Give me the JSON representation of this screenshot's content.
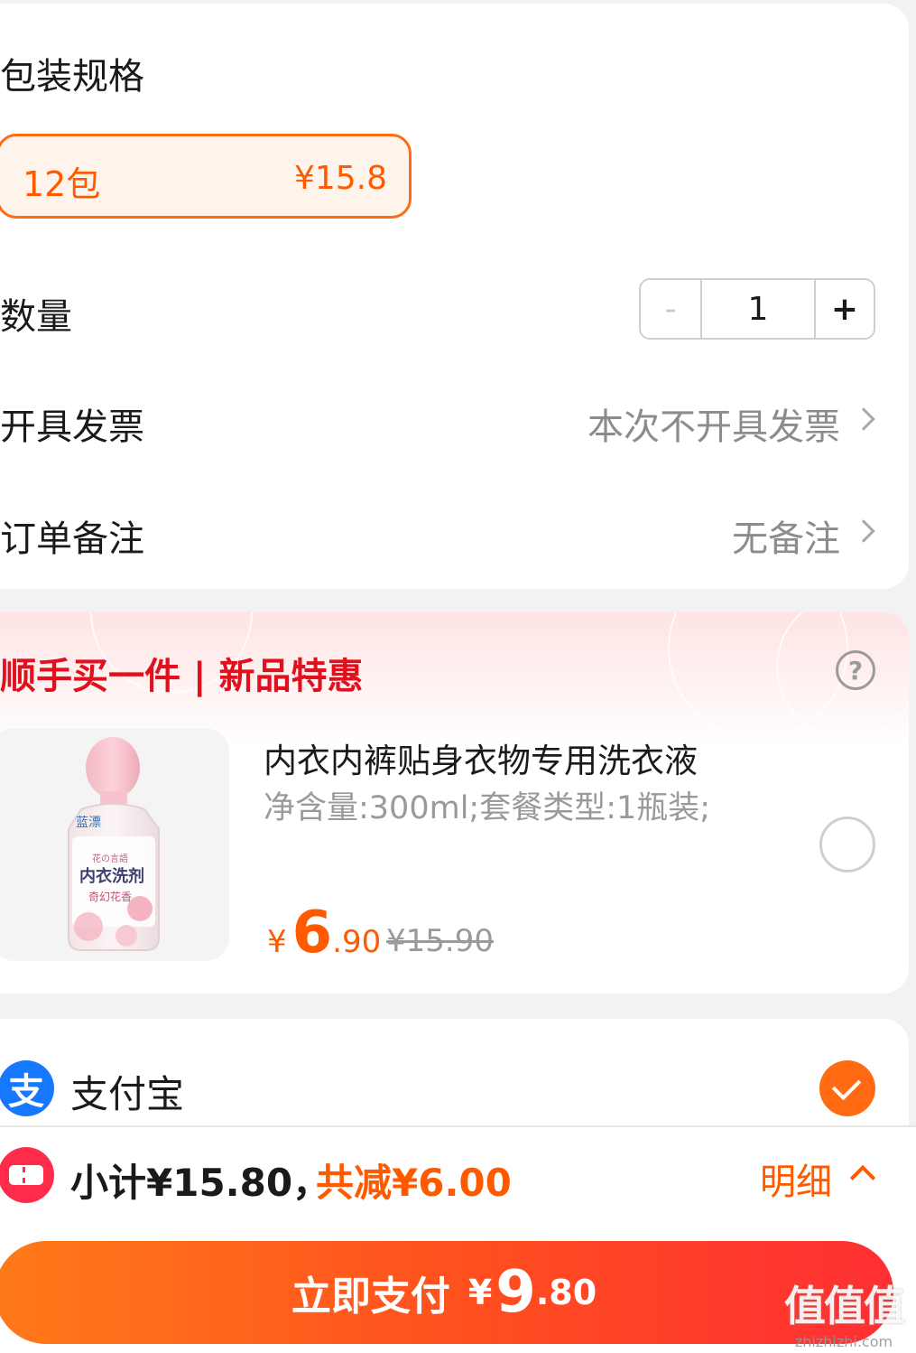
{
  "options": {
    "spec_label": "包装规格",
    "spec_chip": {
      "name": "12包",
      "price": "¥15.8"
    },
    "quantity_label": "数量",
    "quantity": {
      "minus": "-",
      "value": "1",
      "plus": "+"
    },
    "invoice_label": "开具发票",
    "invoice_value": "本次不开具发票",
    "remark_label": "订单备注",
    "remark_value": "无备注"
  },
  "upsell": {
    "title": "顺手买一件 | 新品特惠",
    "help_icon": "?",
    "product": {
      "name": "内衣内裤贴身衣物专用洗衣液",
      "spec": "净含量:300ml;套餐类型:1瓶装;",
      "price_symbol": "¥",
      "price_int": "6",
      "price_dec": ".90",
      "original_price": "¥15.90",
      "bottle_brand": "蓝漂",
      "bottle_text": "花の言語",
      "bottle_title": "内衣洗剂",
      "bottle_scent": "奇幻花香"
    }
  },
  "payment": {
    "method": "支付宝",
    "method_icon": "支",
    "selected": true
  },
  "summary": {
    "subtotal": "小计¥15.80，",
    "discount": "共减¥6.00",
    "details": "明细"
  },
  "pay_button": {
    "label": "立即支付",
    "symbol": "¥",
    "amount_int": "9",
    "amount_dec": ".80"
  },
  "watermark": {
    "chars": "值值值",
    "url": "zhizhizhi.com"
  },
  "colors": {
    "accent": "#ff5a00",
    "upsell_red": "#e0101e",
    "alipay_blue": "#1677ff",
    "background": "#f2f2f2"
  }
}
